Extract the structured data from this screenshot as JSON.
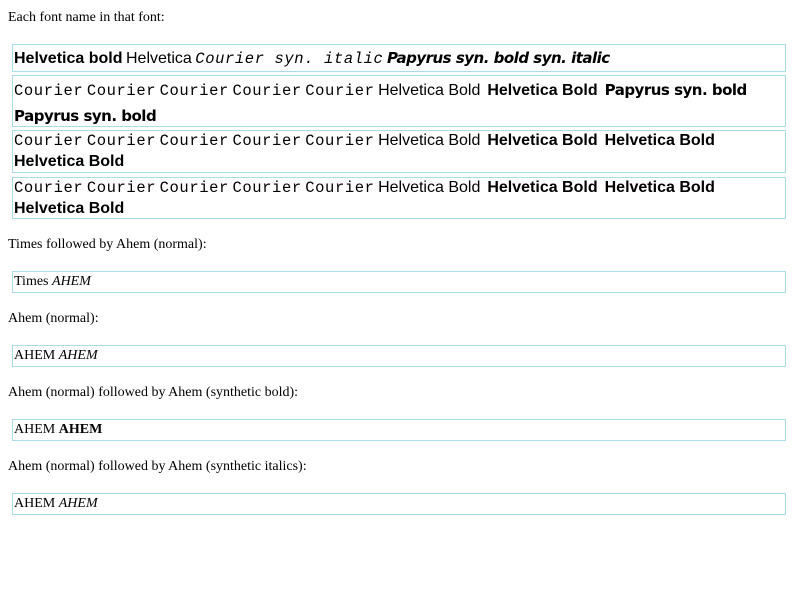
{
  "heading1": "Each font name in that font:",
  "box1": {
    "a": "Helvetica bold",
    "b": "Helvetica",
    "c": "Courier syn. italic",
    "d": "Papyrus syn. bold syn. italic"
  },
  "box2": {
    "courier": [
      "Courier",
      "Courier",
      "Courier",
      "Courier",
      "Courier"
    ],
    "hb": [
      "Helvetica Bold",
      "Helvetica Bold"
    ],
    "p": [
      "Papyrus syn. bold",
      "Papyrus syn. bold"
    ]
  },
  "box3": {
    "courier": [
      "Courier",
      "Courier",
      "Courier",
      "Courier",
      "Courier"
    ],
    "hb": [
      "Helvetica Bold",
      "Helvetica Bold",
      "Helvetica Bold",
      "Helvetica Bold"
    ]
  },
  "box4": {
    "courier": [
      "Courier",
      "Courier",
      "Courier",
      "Courier",
      "Courier"
    ],
    "hb": [
      "Helvetica Bold",
      "Helvetica Bold",
      "Helvetica Bold",
      "Helvetica Bold"
    ]
  },
  "sections": [
    {
      "label": "Times followed by Ahem (normal):",
      "a": "Times",
      "b": "AHEM"
    },
    {
      "label": "Ahem (normal):",
      "a": "AHEM",
      "b": "AHEM"
    },
    {
      "label": "Ahem (normal) followed by Ahem (synthetic bold):",
      "a": "AHEM",
      "b": "AHEM"
    },
    {
      "label": "Ahem (normal) followed by Ahem (synthetic italics):",
      "a": "AHEM",
      "b": "AHEM"
    }
  ]
}
